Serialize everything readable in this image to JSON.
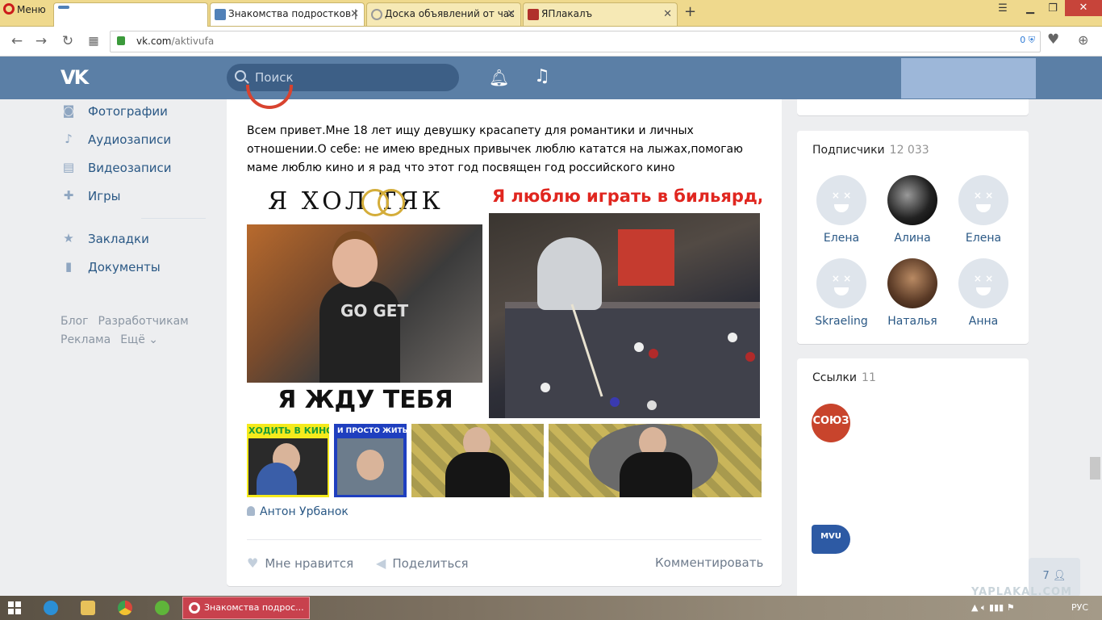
{
  "browser": {
    "menu_label": "Меню",
    "tabs": [
      {
        "title": "",
        "favicon_color": "#5181b8"
      },
      {
        "title": "Знакомства подростков |",
        "favicon_color": "#5181b8"
      },
      {
        "title": "Доска объявлений от час",
        "favicon_color": "#9a9a9a"
      },
      {
        "title": "ЯПлакалъ",
        "favicon_color": "#b0312b"
      }
    ],
    "active_tab_index": 1,
    "address": {
      "domain": "vk.com",
      "path": "/aktivufa"
    },
    "privacy_count": "0"
  },
  "vk": {
    "search_placeholder": "Поиск",
    "nav_items": [
      {
        "label": "Фотографии",
        "icon": "camera-icon"
      },
      {
        "label": "Аудиозаписи",
        "icon": "music-icon"
      },
      {
        "label": "Видеозаписи",
        "icon": "film-icon"
      },
      {
        "label": "Игры",
        "icon": "gamepad-icon"
      }
    ],
    "nav_items_2": [
      {
        "label": "Закладки",
        "icon": "star-icon"
      },
      {
        "label": "Документы",
        "icon": "document-icon"
      }
    ],
    "footer_links": [
      "Блог",
      "Разработчикам",
      "Реклама",
      "Ещё ⌄"
    ]
  },
  "post": {
    "text": "Всем привет.Мне 18 лет ищу девушку красапету для романтики и личных отношении.О себе: не имею вредных привычек люблю кататся на лыжах,помогаю маме люблю кино и я рад что этот год посвящен год российского кино",
    "image_left_title": "Я ХОЛ ТЯК",
    "image_left_shirt": "GO GET",
    "image_left_bottom": "Я ЖДУ ТЕБЯ",
    "image_right_title": "Я люблю играть в бильярд,",
    "thumb1_text": "ХОДИТЬ В КИНО",
    "thumb2_text": "И ПРОСТО ЖИТЬ !",
    "author": "Антон Урбанок",
    "actions": {
      "like": "Мне нравится",
      "share": "Поделиться",
      "comment": "Комментировать"
    }
  },
  "subscribers": {
    "title": "Подписчики",
    "count": "12 033",
    "people": [
      {
        "name": "Елена",
        "avatar": "default-dog"
      },
      {
        "name": "Алина",
        "avatar": "photo"
      },
      {
        "name": "Елена",
        "avatar": "default-dog"
      },
      {
        "name": "Skraeling",
        "avatar": "default-dog"
      },
      {
        "name": "Наталья",
        "avatar": "photo"
      },
      {
        "name": "Анна",
        "avatar": "default-dog"
      }
    ]
  },
  "links_block": {
    "title": "Ссылки",
    "count": "11",
    "link1_logo_text": "СОЮЗ",
    "link2_logo_text": "MVU"
  },
  "online_count": "7",
  "taskbar": {
    "active_task": "Знакомства подрос...",
    "language": "РУС"
  },
  "watermark": "YAPLAKAL.COM",
  "colors": {
    "vk_header": "#5b7fa6",
    "vk_link": "#2a5885",
    "page_bg": "#edeef0",
    "browser_tabbar": "#efd98d",
    "taskbar_active": "#c8414d"
  }
}
